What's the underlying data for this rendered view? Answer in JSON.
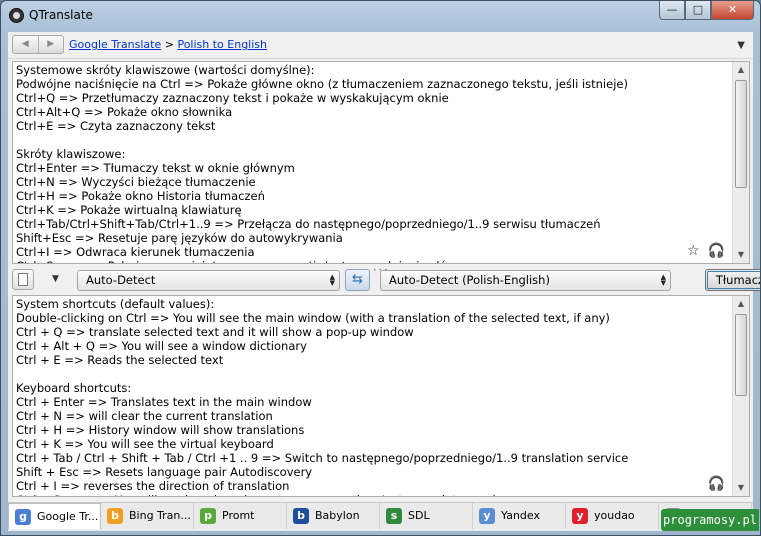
{
  "window": {
    "title": "QTranslate",
    "min_glyph": "—",
    "max_glyph": "□",
    "close_glyph": "✕"
  },
  "nav": {
    "back_glyph": "◀",
    "forward_glyph": "▶",
    "crumb_service": "Google Translate",
    "crumb_separator": ">",
    "crumb_direction": "Polish to English",
    "dropdown_glyph": "▼"
  },
  "source": {
    "lines": [
      "Systemowe skróty klawiszowe (wartości domyślne):",
      "Podwójne naciśnięcie na Ctrl => Pokaże główne okno (z tłumaczeniem zaznaczonego tekstu, jeśli istnieje)",
      "Ctrl+Q => Przetłumaczy zaznaczony tekst i pokaże w wyskakującym oknie",
      "Ctrl+Alt+Q => Pokaże okno słownika",
      "Ctrl+E => Czyta zaznaczony tekst",
      "",
      "Skróty klawiszowe:",
      "Ctrl+Enter => Tłumaczy tekst w oknie głównym",
      "Ctrl+N => Wyczyści bieżące tłumaczenie",
      "Ctrl+H => Pokaże okno Historia tłumaczeń",
      "Ctrl+K => Pokaże wirtualną klawiaturę",
      "Ctrl+Tab/Ctrl+Shift+Tab/Ctrl+1..9 => Przełącza do następnego/poprzedniego/1..9 serwisu tłumaczeń",
      "Shift+Esc => Resetuje parę języków do autowykrywania",
      "Ctrl+I => Odwraca kierunek tłumaczenia",
      "Ctrl+Space => Pokaże w rozwiniętym menu sugestie/autouzupełnienie słów"
    ],
    "star_glyph": "☆",
    "listen_glyph": "🎧"
  },
  "toolbar": {
    "source_language": "Auto-Detect",
    "target_language": "Auto-Detect (Polish-English)",
    "swap_glyph": "⇆",
    "translate_label": "Tłumacz"
  },
  "result": {
    "lines": [
      "System shortcuts (default values):",
      "Double-clicking on Ctrl => You will see the main window (with a translation of the selected text, if any)",
      "Ctrl + Q => translate selected text and it will show a pop-up window",
      "Ctrl + Alt + Q => You will see a window dictionary",
      "Ctrl + E => Reads the selected text",
      "",
      "Keyboard shortcuts:",
      "Ctrl + Enter => Translates text in the main window",
      "Ctrl + N => will clear the current translation",
      "Ctrl + H => History window will show translations",
      "Ctrl + K => You will see the virtual keyboard",
      "Ctrl + Tab / Ctrl + Shift + Tab / Ctrl +1 .. 9 => Switch to następnego/poprzedniego/1..9 translation service",
      "Shift + Esc => Resets language pair Autodiscovery",
      "Ctrl + I => reverses the direction of translation",
      "Ctrl + Space => You will see in a drop-down menu suggestions/autocomplete words"
    ],
    "listen_glyph": "🎧"
  },
  "services": [
    {
      "label": "Google Tr...",
      "icon": "google-icon",
      "color": "#4a7fd4",
      "glyph": "g"
    },
    {
      "label": "Bing Tran...",
      "icon": "bing-icon",
      "color": "#f0a020",
      "glyph": "b"
    },
    {
      "label": "Promt",
      "icon": "promt-icon",
      "color": "#5aa83a",
      "glyph": "p"
    },
    {
      "label": "Babylon",
      "icon": "babylon-icon",
      "color": "#1f4f9a",
      "glyph": "b"
    },
    {
      "label": "SDL",
      "icon": "sdl-icon",
      "color": "#2e8b3e",
      "glyph": "s"
    },
    {
      "label": "Yandex",
      "icon": "yandex-icon",
      "color": "#5a8fd6",
      "glyph": "y"
    },
    {
      "label": "youdao",
      "icon": "youdao-icon",
      "color": "#e0202a",
      "glyph": "y"
    },
    {
      "label": "...",
      "icon": "more-icon",
      "color": "#888888",
      "glyph": "›"
    }
  ],
  "watermark": "programosy.pl"
}
